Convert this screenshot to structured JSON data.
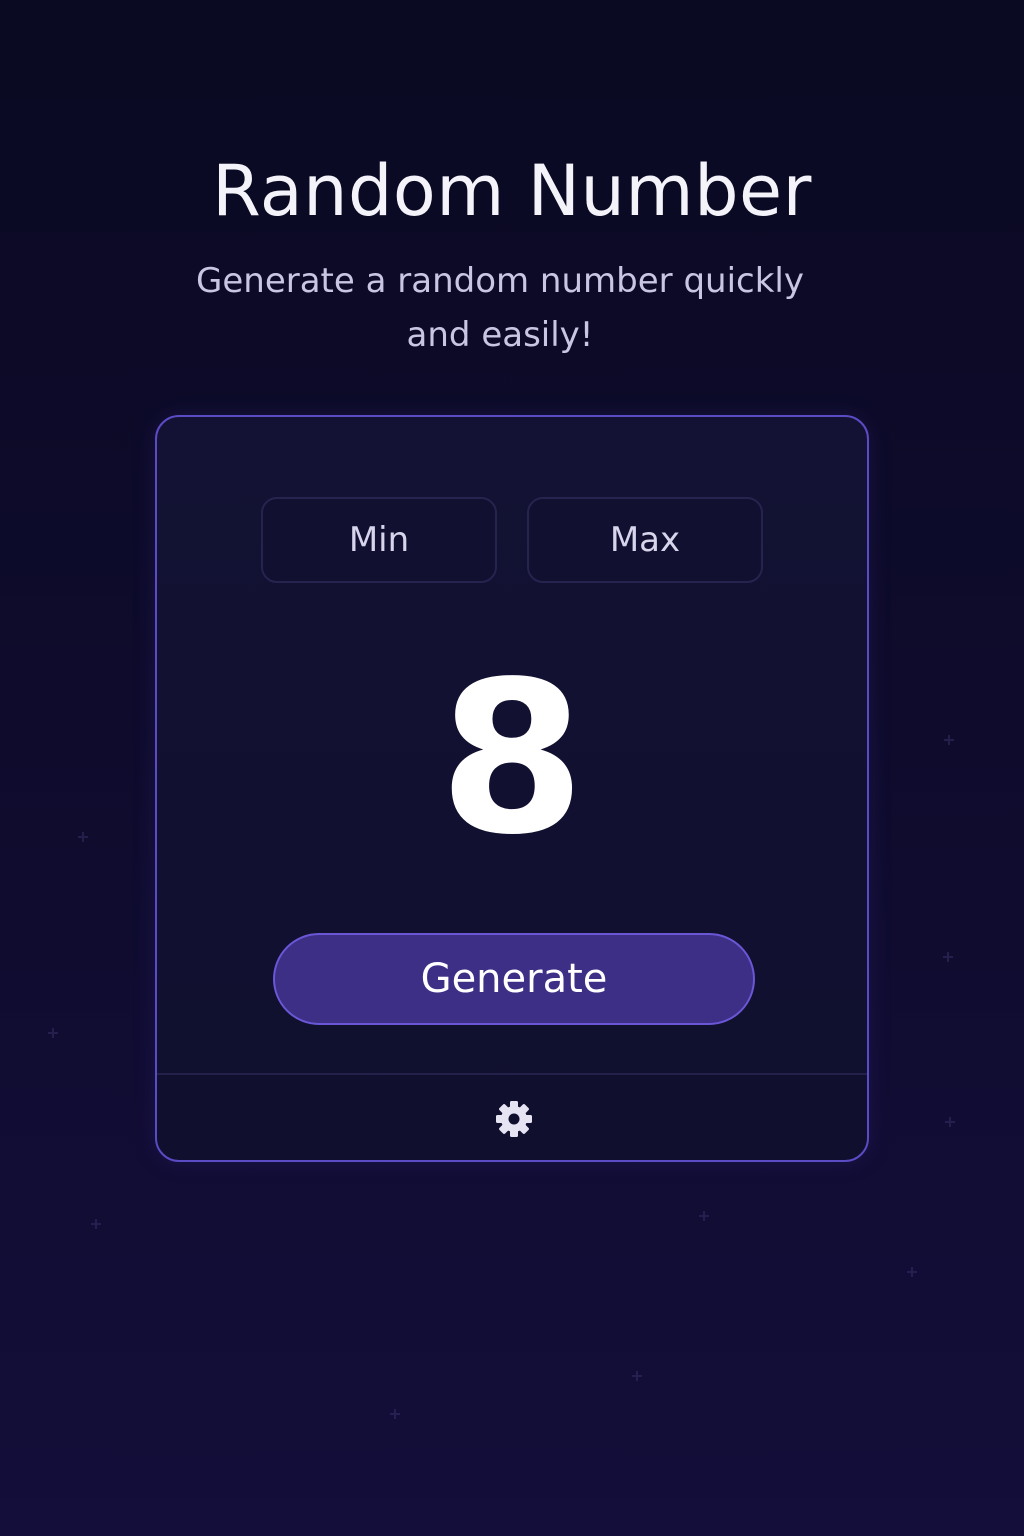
{
  "header": {
    "title": "Random Number",
    "subtitle": "Generate a random number quickly and easily!"
  },
  "generator": {
    "min_placeholder": "Min",
    "max_placeholder": "Max",
    "result": "8",
    "generate_label": "Generate"
  },
  "footer": {
    "settings_icon": "gear-icon"
  },
  "colors": {
    "background": "#0e0b2c",
    "card_border": "#5b4bc4",
    "button_fill": "#3d2e86",
    "button_border": "#6a57d6",
    "text_primary": "#ffffff",
    "text_secondary": "#c9c6e4"
  }
}
